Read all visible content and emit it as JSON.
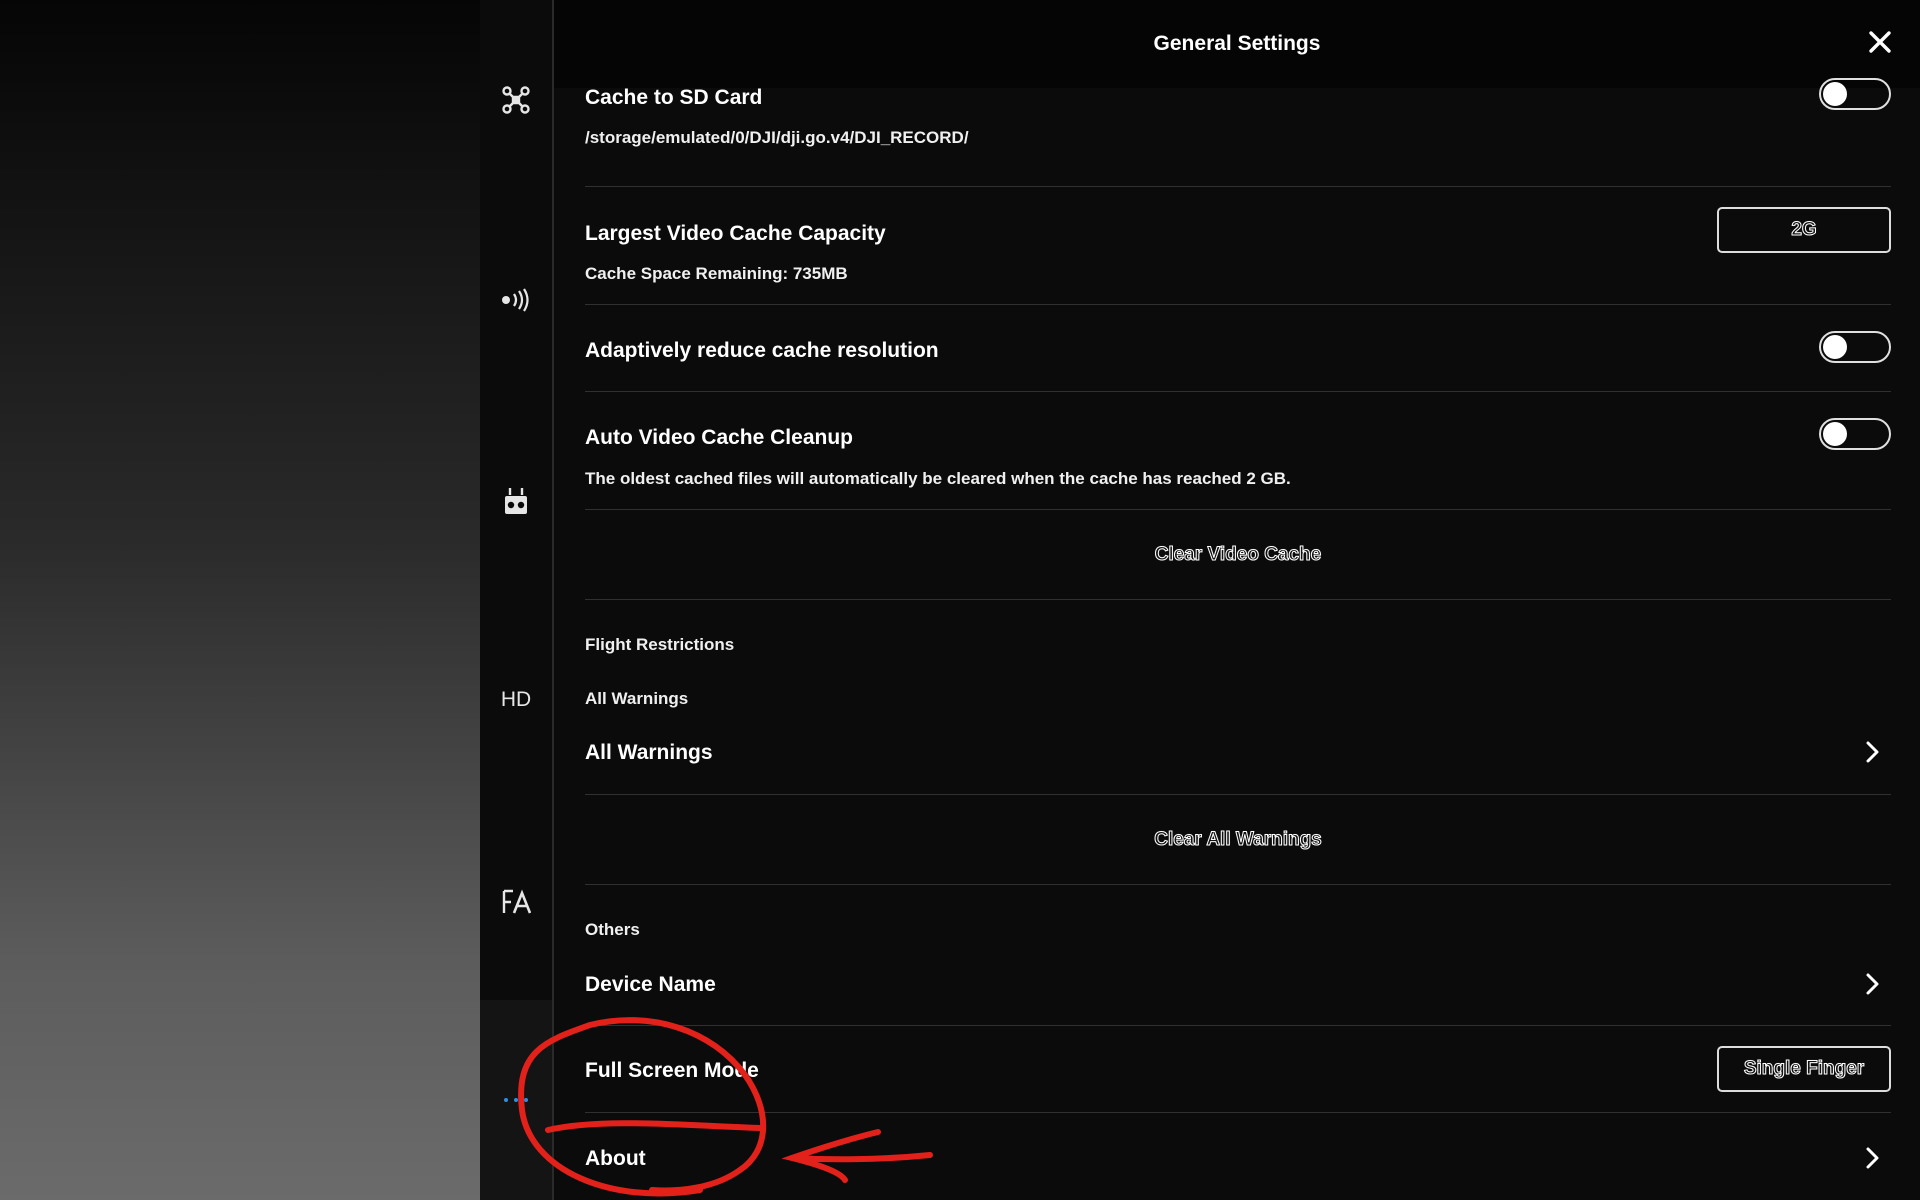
{
  "header": {
    "title": "General Settings"
  },
  "sidebar": {
    "items": [
      {
        "name": "aircraft",
        "icon": "aircraft-icon"
      },
      {
        "name": "signal",
        "icon": "signal-icon"
      },
      {
        "name": "remote-controller",
        "icon": "remote-controller-icon"
      },
      {
        "name": "hd",
        "label": "HD"
      },
      {
        "name": "general",
        "icon": "language-icon"
      },
      {
        "name": "more",
        "icon": "more-icon"
      }
    ]
  },
  "settings": {
    "cache_sd": {
      "label": "Cache to SD Card",
      "path": "/storage/emulated/0/DJI/dji.go.v4/DJI_RECORD/",
      "enabled": false
    },
    "largest_cache": {
      "label": "Largest Video Cache Capacity",
      "value": "2G",
      "remaining": "Cache Space Remaining: 735MB"
    },
    "adaptive": {
      "label": "Adaptively reduce cache resolution",
      "enabled": false
    },
    "auto_cleanup": {
      "label": "Auto Video Cache Cleanup",
      "description": "The oldest cached files will automatically be cleared when the cache has reached 2 GB.",
      "enabled": false
    },
    "clear_video_cache": "Clear Video Cache",
    "flight_restrictions": {
      "section": "Flight Restrictions",
      "subtitle": "All Warnings",
      "row_label": "All Warnings"
    },
    "clear_all_warnings": "Clear All Warnings",
    "others": {
      "section": "Others",
      "device_name": "Device Name",
      "full_screen_mode": "Full Screen Mode",
      "full_screen_value": "Single Finger",
      "about": "About"
    }
  },
  "colors": {
    "accent": "#2f8de4",
    "annotation": "#e3211b"
  }
}
